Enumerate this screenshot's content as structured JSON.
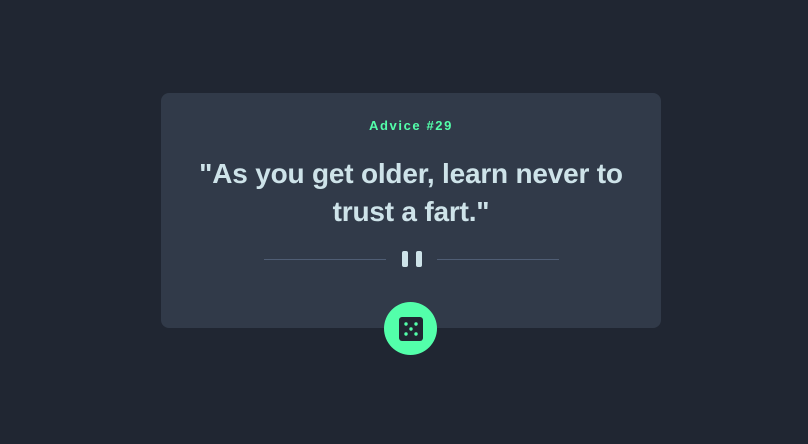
{
  "advice": {
    "id_label": "Advice #29",
    "quote": "\"As you get older, learn never to trust a fart.\""
  },
  "colors": {
    "background": "#202632",
    "card": "#313A49",
    "accent": "#53FFAA",
    "text": "#CEE3E9",
    "divider": "#4F5D74"
  },
  "icons": {
    "divider": "pause-icon",
    "button": "dice-icon"
  }
}
